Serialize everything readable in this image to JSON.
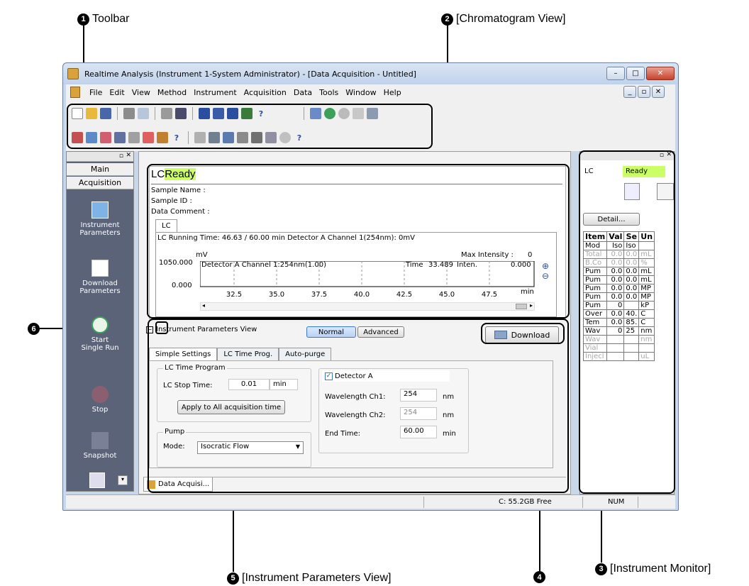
{
  "callouts": {
    "c1": {
      "num": "1",
      "label": "Toolbar"
    },
    "c2": {
      "num": "2",
      "label": "[Chromatogram View]"
    },
    "c3": {
      "num": "3",
      "label": "[Instrument Monitor]"
    },
    "c4": {
      "num": "4"
    },
    "c5": {
      "num": "5",
      "label": "[Instrument Parameters View]"
    },
    "c6": {
      "num": "6"
    }
  },
  "window": {
    "title": "Realtime Analysis (Instrument 1-System Administrator) - [Data Acquisition - Untitled]",
    "minimize": "–",
    "maximize": "□",
    "close": "✕",
    "child_min": "_",
    "child_restore": "▫",
    "child_close": "✕"
  },
  "menu": [
    "File",
    "Edit",
    "View",
    "Method",
    "Instrument",
    "Acquisition",
    "Data",
    "Tools",
    "Window",
    "Help"
  ],
  "sidebar": {
    "tab_main": "Main",
    "tab_acq": "Acquisition",
    "items": [
      {
        "label": "Instrument\nParameters"
      },
      {
        "label": "Download\nParameters"
      },
      {
        "label": "Start\nSingle Run"
      },
      {
        "label": "Stop"
      },
      {
        "label": "Snapshot"
      }
    ]
  },
  "chrom": {
    "lc": "LC",
    "status": "Ready",
    "sample_name": "Sample Name :",
    "sample_id": "Sample ID :",
    "data_comment": "Data Comment :",
    "tab": "LC",
    "running": "LC Running Time: 46.63 / 60.00 min Detector A Channel 1(254nm): 0mV",
    "max_label": "Max Intensity :",
    "max_value": "0",
    "unit": "mV",
    "y_top": "1050.000",
    "y_bottom": "0.000",
    "legend": "Detector A Channel 1:254nm(1.00)",
    "time_label": "Time",
    "time_value": "33.489",
    "inten_label": "Inten.",
    "inten_value": "0.000",
    "x_unit": "min"
  },
  "chart_data": {
    "type": "line",
    "series": [
      {
        "name": "Detector A Channel 1:254nm(1.00)",
        "x": [],
        "y": []
      }
    ],
    "x_ticks": [
      "32.5",
      "35.0",
      "37.5",
      "40.0",
      "42.5",
      "45.0",
      "47.5"
    ],
    "ylim": [
      0.0,
      1050.0
    ],
    "xlabel": "min",
    "ylabel": "mV"
  },
  "params": {
    "header": "Instrument Parameters View",
    "normal": "Normal",
    "advanced": "Advanced",
    "download": "Download",
    "tabs": [
      "Simple Settings",
      "LC Time Prog.",
      "Auto-purge"
    ],
    "lc_time_program": "LC Time Program",
    "lc_stop_time_label": "LC Stop Time:",
    "lc_stop_time_value": "0.01",
    "lc_stop_time_unit": "min",
    "apply_all": "Apply to All acquisition time",
    "pump": "Pump",
    "mode_label": "Mode:",
    "mode_value": "Isocratic Flow",
    "detector_a": "Detector A",
    "wl1_label": "Wavelength Ch1:",
    "wl1_value": "254",
    "wl1_unit": "nm",
    "wl2_label": "Wavelength Ch2:",
    "wl2_value": "254",
    "wl2_unit": "nm",
    "end_label": "End Time:",
    "end_value": "60.00",
    "end_unit": "min",
    "bottom_tab": "Data Acquisi..."
  },
  "monitor": {
    "lc": "LC",
    "status": "Ready",
    "detail": "Detail...",
    "headers": [
      "Item",
      "Val",
      "Se",
      "Un"
    ],
    "rows": [
      [
        "Mod",
        "Iso",
        "Iso",
        ""
      ],
      [
        "Total",
        "0.0",
        "0.0",
        "mL"
      ],
      [
        "B.Co",
        "0.0",
        "0.0",
        "%"
      ],
      [
        "Pum",
        "0.0",
        "0.0",
        "mL"
      ],
      [
        "Pum",
        "0.0",
        "0.0",
        "mL"
      ],
      [
        "Pum",
        "0.0",
        "0.0",
        "MP"
      ],
      [
        "Pum",
        "0.0",
        "0.0",
        "MP"
      ],
      [
        "Pum",
        "0",
        "",
        "kP"
      ],
      [
        "Over",
        "0.0",
        "40.",
        "C"
      ],
      [
        "Tem",
        "0.0",
        "85.",
        "C"
      ],
      [
        "Wav",
        "0",
        "25",
        "nm"
      ],
      [
        "Wav",
        "",
        "",
        "nm"
      ],
      [
        "Vial",
        "",
        "",
        ""
      ],
      [
        "Injecl",
        "",
        "",
        "uL"
      ]
    ],
    "dim_rows": [
      1,
      2,
      11,
      12,
      13
    ]
  },
  "statusbar": {
    "disk": "C: 55.2GB Free",
    "num": "NUM"
  },
  "colors": {
    "ready_bg": "#ccff66",
    "sidebar_bg": "#5a6378",
    "accent": "#3c78d8"
  }
}
